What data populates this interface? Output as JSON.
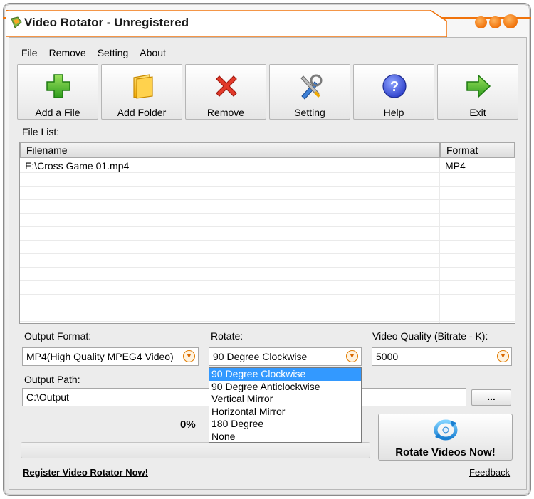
{
  "window": {
    "title": "Video Rotator - Unregistered"
  },
  "menu": [
    "File",
    "Remove",
    "Setting",
    "About"
  ],
  "toolbar": [
    {
      "label": "Add a File",
      "icon": "plus-icon"
    },
    {
      "label": "Add Folder",
      "icon": "folder-icon"
    },
    {
      "label": "Remove",
      "icon": "x-icon"
    },
    {
      "label": "Setting",
      "icon": "tools-icon"
    },
    {
      "label": "Help",
      "icon": "help-icon"
    },
    {
      "label": "Exit",
      "icon": "arrow-right-icon"
    }
  ],
  "file_list": {
    "label": "File List:",
    "columns": [
      "Filename",
      "Format"
    ],
    "rows": [
      {
        "filename": "E:\\Cross Game 01.mp4",
        "format": "MP4"
      }
    ]
  },
  "output_format": {
    "label": "Output Format:",
    "value": "MP4(High Quality MPEG4 Video)"
  },
  "rotate": {
    "label": "Rotate:",
    "value": "90 Degree Clockwise",
    "options": [
      "90 Degree Clockwise",
      "90 Degree Anticlockwise",
      "Vertical Mirror",
      "Horizontal Mirror",
      "180 Degree",
      "None"
    ],
    "selected_index": 0
  },
  "video_quality": {
    "label": "Video Quality (Bitrate - K):",
    "value": "5000"
  },
  "output_path": {
    "label": "Output Path:",
    "value": "C:\\Output",
    "browse_label": "..."
  },
  "progress": {
    "percent_text": "0%",
    "fraction": 0.0
  },
  "rotate_button": {
    "label": "Rotate Videos Now!"
  },
  "links": {
    "register": "Register Video Rotator Now!",
    "feedback": "Feedback"
  },
  "colors": {
    "accent": "#f0730b",
    "selection": "#3399ff"
  }
}
